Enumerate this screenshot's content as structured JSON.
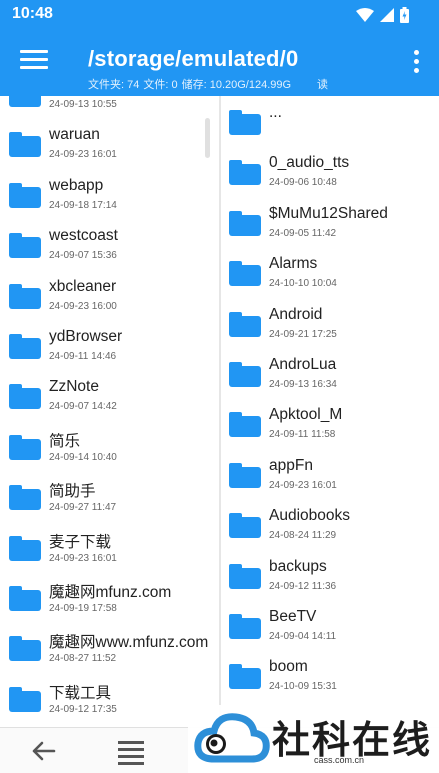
{
  "status": {
    "time": "10:48"
  },
  "toolbar": {
    "path": "/storage/emulated/0",
    "folders_label": "文件夹: 74",
    "files_label": "文件: 0",
    "storage_label": "储存: 10.20G/124.99G",
    "permission": "读"
  },
  "left_pane": {
    "items": [
      {
        "name": "",
        "date": "24-09-13 10:55"
      },
      {
        "name": "waruan",
        "date": "24-09-23 16:01"
      },
      {
        "name": "webapp",
        "date": "24-09-18 17:14"
      },
      {
        "name": "westcoast",
        "date": "24-09-07 15:36"
      },
      {
        "name": "xbcleaner",
        "date": "24-09-23 16:00"
      },
      {
        "name": "ydBrowser",
        "date": "24-09-11 14:46"
      },
      {
        "name": "ZzNote",
        "date": "24-09-07 14:42"
      },
      {
        "name": "简乐",
        "date": "24-09-14 10:40"
      },
      {
        "name": "简助手",
        "date": "24-09-27 11:47"
      },
      {
        "name": "麦子下载",
        "date": "24-09-23 16:01"
      },
      {
        "name": "魔趣网mfunz.com",
        "date": "24-09-19 17:58"
      },
      {
        "name": "魔趣网www.mfunz.com",
        "date": "24-08-27 11:52"
      },
      {
        "name": "下载工具",
        "date": "24-09-12 17:35"
      }
    ]
  },
  "right_pane": {
    "items": [
      {
        "name": "...",
        "date": ""
      },
      {
        "name": "0_audio_tts",
        "date": "24-09-06 10:48"
      },
      {
        "name": "$MuMu12Shared",
        "date": "24-09-05 11:42"
      },
      {
        "name": "Alarms",
        "date": "24-10-10 10:04"
      },
      {
        "name": "Android",
        "date": "24-09-21 17:25"
      },
      {
        "name": "AndroLua",
        "date": "24-09-13 16:34"
      },
      {
        "name": "Apktool_M",
        "date": "24-09-11 11:58"
      },
      {
        "name": "appFn",
        "date": "24-09-23 16:01"
      },
      {
        "name": "Audiobooks",
        "date": "24-08-24 11:29"
      },
      {
        "name": "backups",
        "date": "24-09-12 11:36"
      },
      {
        "name": "BeeTV",
        "date": "24-09-04 14:11"
      },
      {
        "name": "boom",
        "date": "24-10-09 15:31"
      }
    ]
  },
  "watermark": {
    "text": "社科在线",
    "domain": "cass.com.cn"
  },
  "colors": {
    "primary": "#2196f3",
    "folder": "#2196f3"
  }
}
